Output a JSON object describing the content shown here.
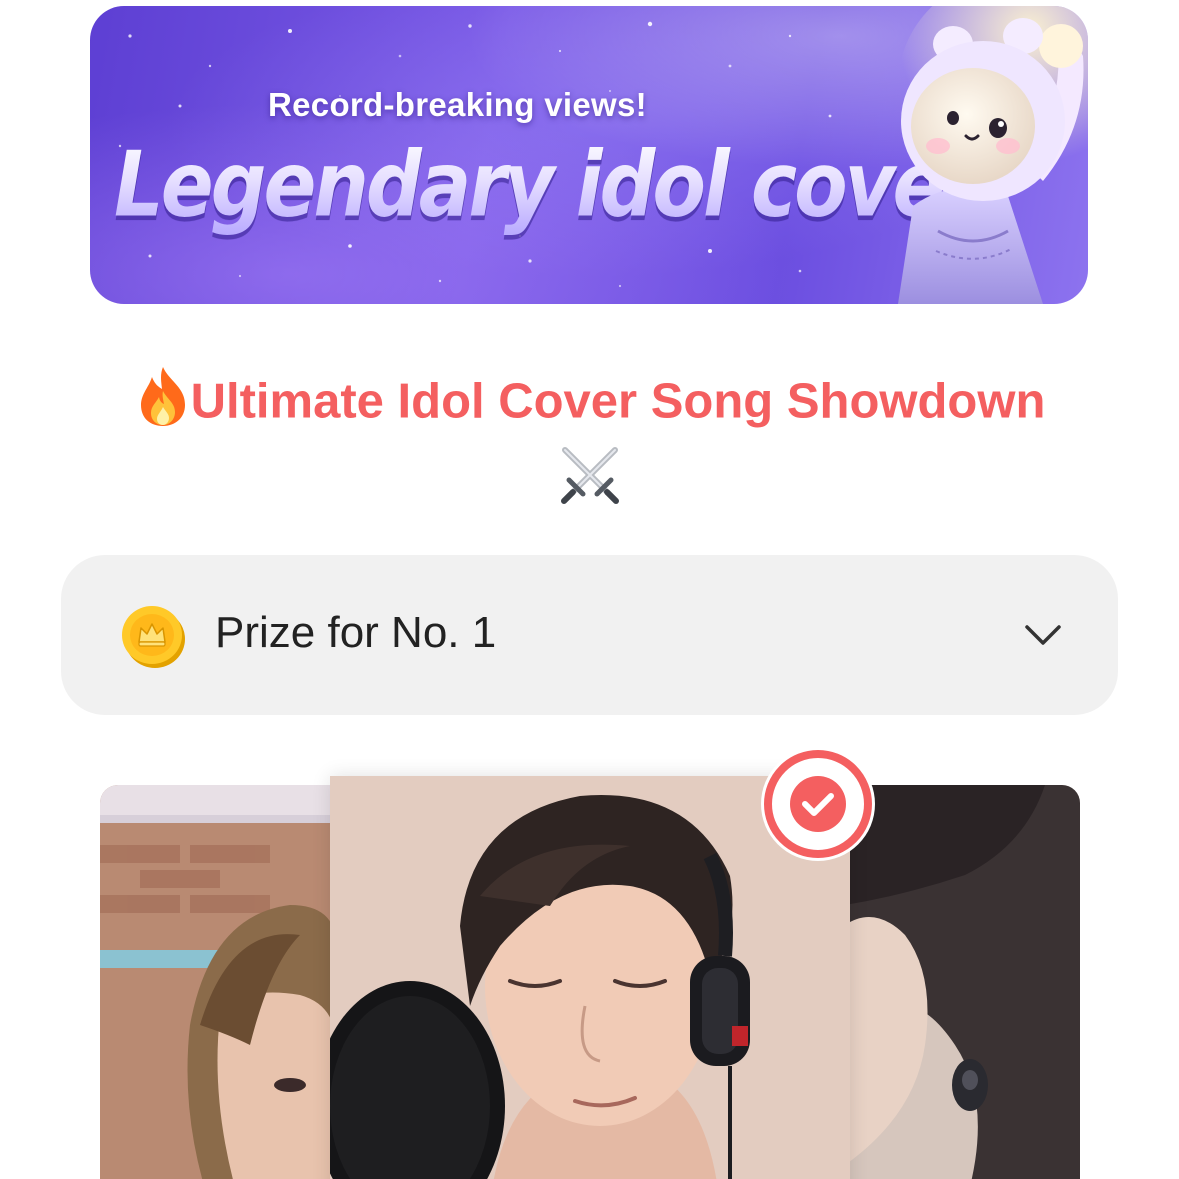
{
  "banner": {
    "subtitle": "Record-breaking views!",
    "title": "Legendary idol cover?"
  },
  "heading": {
    "fire_icon": "fire-emoji",
    "text": "Ultimate Idol Cover Song Showdown",
    "swords_icon": "crossed-swords-emoji"
  },
  "prize": {
    "icon": "gold-crown-coin-icon",
    "label": "Prize for No. 1",
    "expand_icon": "chevron-down-icon"
  },
  "cards": [
    {
      "position": "left",
      "description": "Singer with light brown hair in a studio",
      "selected": false
    },
    {
      "position": "center",
      "description": "Singer with headphones at a microphone",
      "selected": true
    },
    {
      "position": "right",
      "description": "Singer with in-ear monitor",
      "selected": false
    }
  ],
  "colors": {
    "accent": "#f45f60",
    "prize_bg": "#f1f1f1",
    "banner_purple": "#6b4ee0",
    "text": "#222222"
  }
}
